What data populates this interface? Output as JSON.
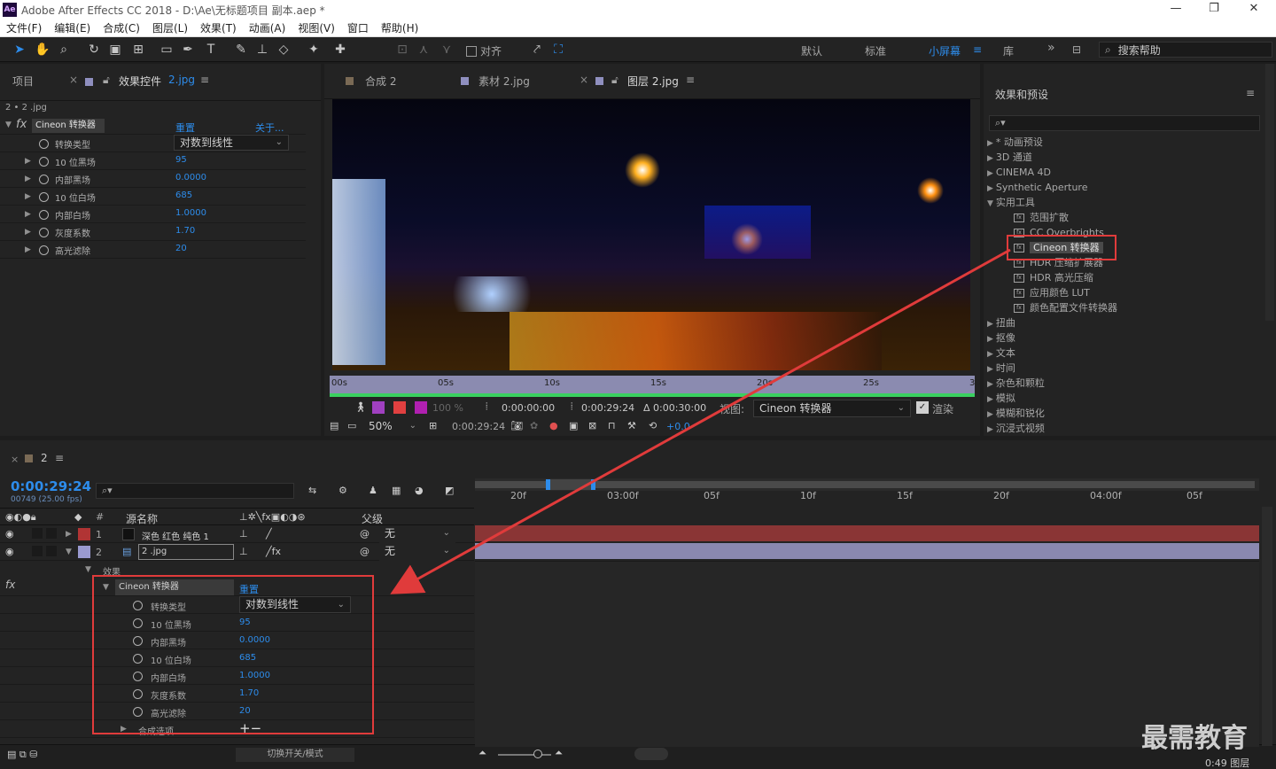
{
  "window": {
    "app_icon": "Ae",
    "title": "Adobe After Effects CC 2018 - D:\\Ae\\无标题项目 副本.aep *",
    "controls": [
      "—",
      "❐",
      "✕"
    ]
  },
  "menu": [
    "文件(F)",
    "编辑(E)",
    "合成(C)",
    "图层(L)",
    "效果(T)",
    "动画(A)",
    "视图(V)",
    "窗口",
    "帮助(H)"
  ],
  "toolbar": {
    "snap_label": "对齐",
    "workspaces": [
      "默认",
      "标准",
      "小屏幕",
      "库"
    ],
    "active_workspace": "小屏幕",
    "overflow": "»",
    "search_placeholder": "搜索帮助"
  },
  "left_panel": {
    "tab_project": "项目",
    "tab_effect_controls": "效果控件",
    "effect_target": "2.jpg",
    "breadcrumb": "2 • 2 .jpg",
    "effect_name": "Cineon 转换器",
    "reset": "重置",
    "about": "关于...",
    "properties": [
      {
        "label": "转换类型",
        "value": "对数到线性",
        "type": "dropdown"
      },
      {
        "label": "10 位黑场",
        "value": "95"
      },
      {
        "label": "内部黑场",
        "value": "0.0000"
      },
      {
        "label": "10 位白场",
        "value": "685"
      },
      {
        "label": "内部白场",
        "value": "1.0000"
      },
      {
        "label": "灰度系数",
        "value": "1.70"
      },
      {
        "label": "高光滤除",
        "value": "20"
      }
    ]
  },
  "viewer": {
    "tabs": [
      {
        "label": "合成 2",
        "color": "#7a6a55"
      },
      {
        "label": "素材 2.jpg",
        "color": "#8f8fbf"
      },
      {
        "label": "图层 2.jpg",
        "color": "#8f8fbf"
      }
    ],
    "active_tab": "图层 2.jpg",
    "ruler_ticks": [
      "00s",
      "05s",
      "10s",
      "15s",
      "20s",
      "25s",
      "30"
    ],
    "opacity": "100 %",
    "in_time": "0:00:00:00",
    "out_time": "0:00:29:24",
    "duration": "Δ 0:00:30:00",
    "view_label": "视图:",
    "view_value": "Cineon 转换器",
    "render_label": "渲染",
    "zoom": "50%",
    "current_time": "0:00:29:24",
    "exposure": "+0.0"
  },
  "effects_presets": {
    "title": "效果和预设",
    "search_icon": "search-icon",
    "items": [
      {
        "label": "* 动画预设",
        "level": 0,
        "expanded": false
      },
      {
        "label": "3D 通道",
        "level": 0,
        "expanded": false
      },
      {
        "label": "CINEMA 4D",
        "level": 0,
        "expanded": false
      },
      {
        "label": "Synthetic Aperture",
        "level": 0,
        "expanded": false
      },
      {
        "label": "实用工具",
        "level": 0,
        "expanded": true
      },
      {
        "label": "范围扩散",
        "level": 1
      },
      {
        "label": "CC Overbrights",
        "level": 1
      },
      {
        "label": "Cineon 转换器",
        "level": 1,
        "selected": true
      },
      {
        "label": "HDR 压缩扩展器",
        "level": 1
      },
      {
        "label": "HDR 高光压缩",
        "level": 1
      },
      {
        "label": "应用颜色 LUT",
        "level": 1
      },
      {
        "label": "颜色配置文件转换器",
        "level": 1
      },
      {
        "label": "扭曲",
        "level": 0,
        "expanded": false
      },
      {
        "label": "抠像",
        "level": 0,
        "expanded": false
      },
      {
        "label": "文本",
        "level": 0,
        "expanded": false
      },
      {
        "label": "时间",
        "level": 0,
        "expanded": false
      },
      {
        "label": "杂色和颗粒",
        "level": 0,
        "expanded": false
      },
      {
        "label": "模拟",
        "level": 0,
        "expanded": false
      },
      {
        "label": "模糊和锐化",
        "level": 0,
        "expanded": false
      },
      {
        "label": "沉浸式视频",
        "level": 0,
        "expanded": false
      }
    ]
  },
  "timeline": {
    "comp_tab": "2",
    "timecode": "0:00:29:24",
    "frame_info": "00749 (25.00 fps)",
    "columns": {
      "source_name": "源名称",
      "parent": "父级",
      "index": "#"
    },
    "layers": [
      {
        "index": "1",
        "name": "深色 红色 纯色 1",
        "label_color": "#b13434",
        "parent": "无",
        "expanded": false
      },
      {
        "index": "2",
        "name": "2 .jpg",
        "label_color": "#9a9ad0",
        "parent": "无",
        "expanded": true
      }
    ],
    "effects_group": "效果",
    "effect_name": "Cineon 转换器",
    "reset": "重置",
    "properties": [
      {
        "label": "转换类型",
        "value": "对数到线性",
        "type": "dropdown"
      },
      {
        "label": "10 位黑场",
        "value": "95"
      },
      {
        "label": "内部黑场",
        "value": "0.0000"
      },
      {
        "label": "10 位白场",
        "value": "685"
      },
      {
        "label": "内部白场",
        "value": "1.0000"
      },
      {
        "label": "灰度系数",
        "value": "1.70"
      },
      {
        "label": "高光滤除",
        "value": "20"
      }
    ],
    "compositing_options": "合成选项",
    "add_remove": "+−",
    "ruler_ticks": [
      "20f",
      "03:00f",
      "05f",
      "10f",
      "15f",
      "20f",
      "04:00f",
      "05f"
    ],
    "toggle_label": "切换开关/模式",
    "bottom_right": "0:49 图层"
  },
  "watermark": "最需教育",
  "colors": {
    "accent": "#2d8ceb",
    "annotation_red": "#e03b3b",
    "layer1_bar": "#8a3535",
    "layer2_bar": "#8a88b0"
  }
}
